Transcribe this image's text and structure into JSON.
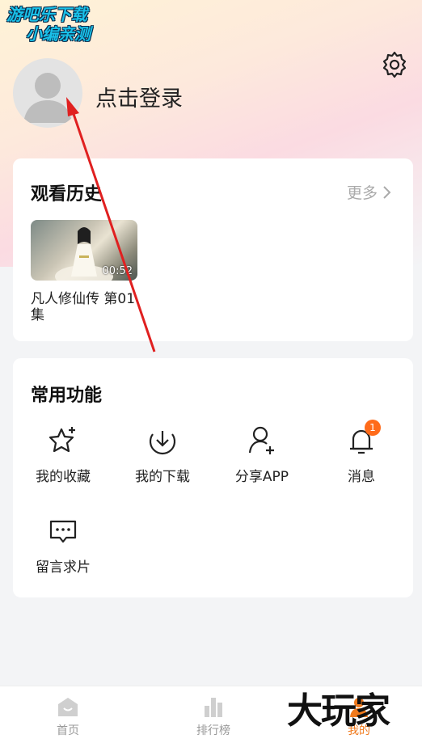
{
  "watermark": {
    "line1": "游吧乐下载",
    "line2": "小编亲测"
  },
  "profile": {
    "login_label": "点击登录"
  },
  "history": {
    "title": "观看历史",
    "more_label": "更多",
    "items": [
      {
        "title": "凡人修仙传 第01集",
        "duration": "00:52"
      }
    ]
  },
  "functions": {
    "title": "常用功能",
    "items": [
      {
        "label": "我的收藏",
        "icon": "star-icon"
      },
      {
        "label": "我的下载",
        "icon": "download-icon"
      },
      {
        "label": "分享APP",
        "icon": "add-user-icon"
      },
      {
        "label": "消息",
        "icon": "bell-icon",
        "badge": "1"
      },
      {
        "label": "留言求片",
        "icon": "message-icon"
      }
    ]
  },
  "tabbar": {
    "items": [
      {
        "label": "首页",
        "icon": "home-icon"
      },
      {
        "label": "排行榜",
        "icon": "chart-icon"
      },
      {
        "label": "我的",
        "icon": "profile-icon",
        "active": true
      }
    ]
  },
  "brand_logo": "大玩家",
  "colors": {
    "accent": "#f07a1d",
    "badge": "#ff6b1a",
    "arrow": "#e02020"
  }
}
